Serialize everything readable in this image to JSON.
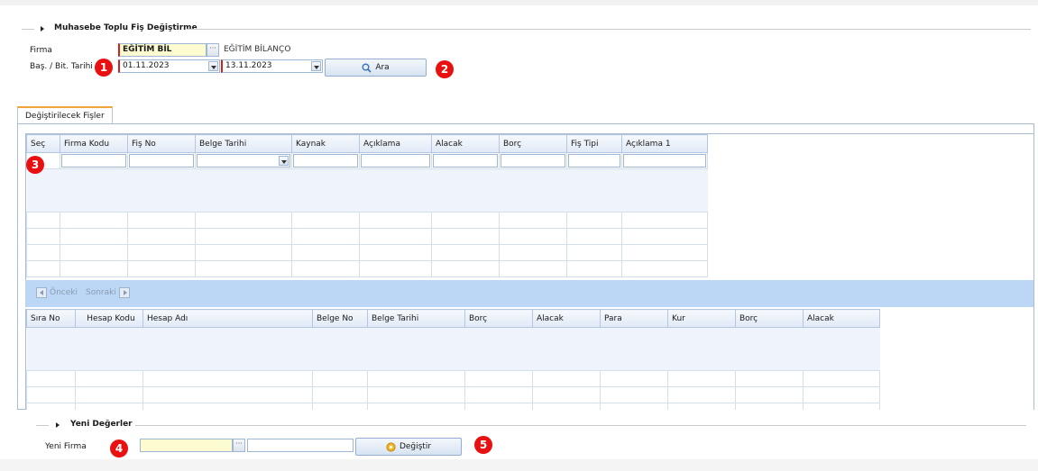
{
  "header": {
    "title": "Muhasebe Toplu Fiş Değiştirme"
  },
  "form": {
    "firma_label": "Firma",
    "firma_code": "EĞİTİM BİL",
    "firma_name": "EĞİTİM BİLANÇO",
    "date_label": "Baş. / Bit. Tarihi",
    "start_date": "01.11.2023",
    "end_date": "13.11.2023",
    "search_label": "Ara"
  },
  "tabs": [
    {
      "label": "Değiştirilecek Fişler"
    }
  ],
  "grid1": {
    "columns": [
      "Seç",
      "Firma Kodu",
      "Fiş No",
      "Belge Tarihi",
      "Kaynak",
      "Açıklama",
      "Alacak",
      "Borç",
      "Fiş Tipi",
      "Açıklama 1"
    ]
  },
  "pager": {
    "prev_label": "Önceki",
    "next_label": "Sonraki"
  },
  "grid2": {
    "columns": [
      "Sıra No",
      "Hesap Kodu",
      "Hesap Adı",
      "Belge No",
      "Belge Tarihi",
      "Borç",
      "Alacak",
      "Para",
      "Kur",
      "Borç",
      "Alacak"
    ]
  },
  "new_values": {
    "title": "Yeni Değerler",
    "firma_label": "Yeni Firma",
    "firma_code": "",
    "firma_name": "",
    "change_label": "Değiştir"
  },
  "badges": [
    "1",
    "2",
    "3",
    "4",
    "5"
  ],
  "colors": {
    "badge": "#e81010",
    "pager": "#bcd6f5",
    "tab_accent": "#f0a33a",
    "required_field": "#fdfbd0"
  },
  "icons": {
    "search": "magnifier-icon",
    "change": "gear-icon",
    "lookup": "ellipsis-icon"
  }
}
